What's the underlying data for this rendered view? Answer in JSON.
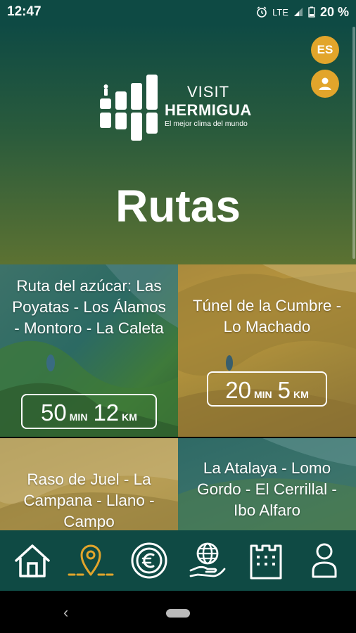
{
  "status_bar": {
    "time": "12:47",
    "network": "LTE",
    "battery": "20 %"
  },
  "header": {
    "language_button": "ES",
    "logo": {
      "visit": "VISIT",
      "name": "HERMIGUA",
      "tagline": "El mejor clima del mundo"
    },
    "title": "Rutas"
  },
  "routes": [
    {
      "name": "Ruta del azúcar: Las Poyatas - Los Álamos - Montoro - La Caleta",
      "minutes": "50",
      "min_unit": "MIN",
      "km": "12",
      "km_unit": "KM"
    },
    {
      "name": "Túnel de la Cumbre - Lo Machado",
      "minutes": "20",
      "min_unit": "MIN",
      "km": "5",
      "km_unit": "KM"
    },
    {
      "name": "Raso de Juel - La Campana - Llano - Campo"
    },
    {
      "name": "La Atalaya - Lomo Gordo - El Cerrillal - Ibo Alfaro"
    }
  ],
  "bottom_nav": {
    "items": [
      "home-icon",
      "map-pin-icon",
      "euro-coin-icon",
      "globe-hand-icon",
      "castle-icon",
      "person-icon"
    ],
    "active": "map-pin-icon",
    "active_color": "#e2a52b",
    "icon_color": "#ffffff"
  },
  "colors": {
    "header_top": "#0e4a44",
    "header_bottom": "#5c7232",
    "accent": "#e2a52b",
    "nav_bg": "#0f4a44"
  }
}
